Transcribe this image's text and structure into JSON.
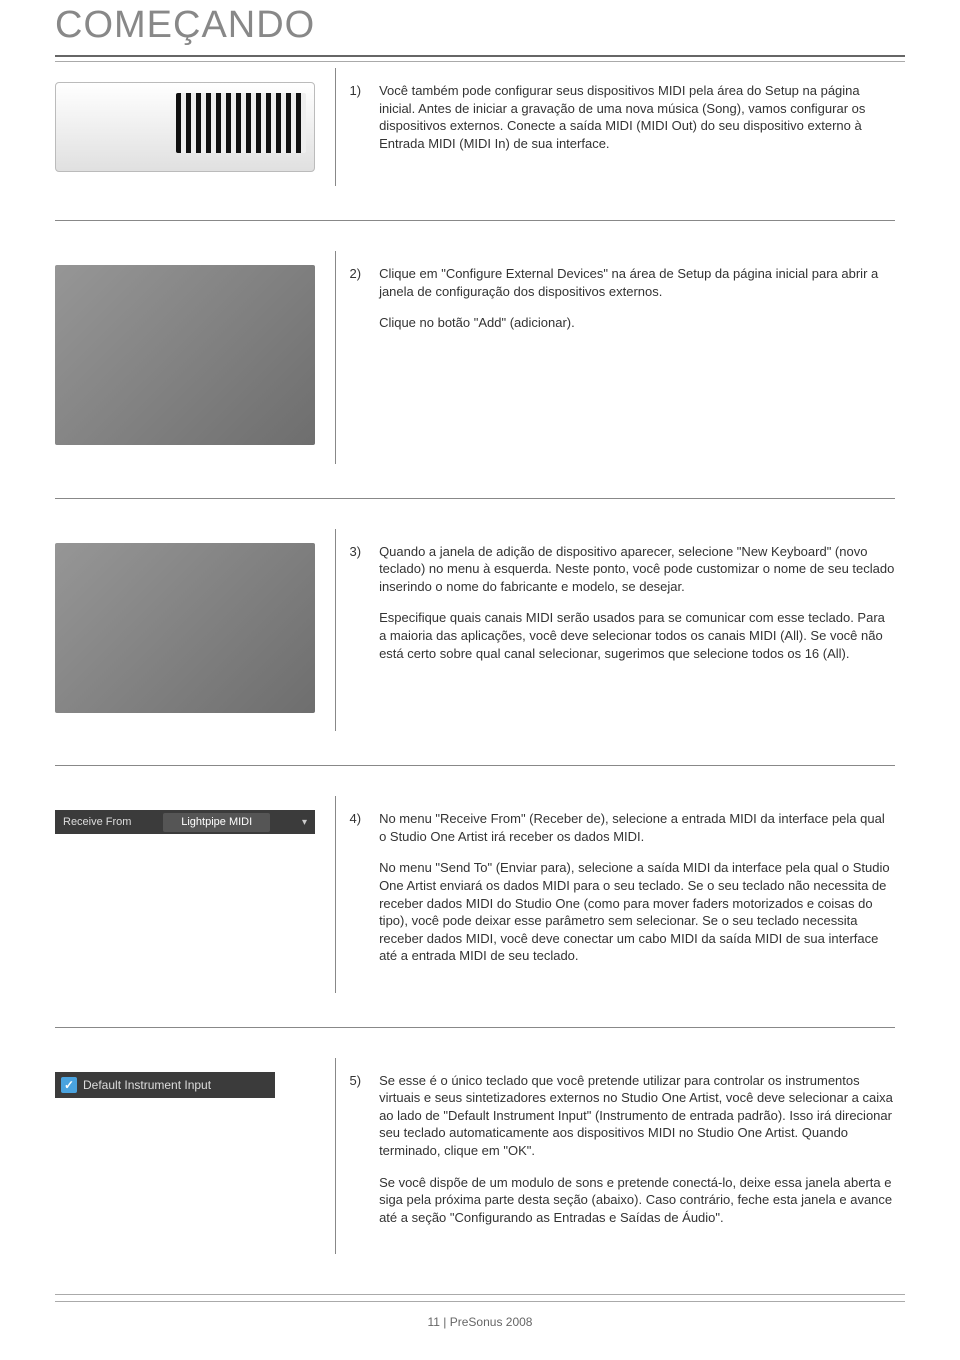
{
  "title": "COMEÇANDO",
  "steps": [
    {
      "num": "1)",
      "paras": [
        "Você também pode configurar seus dispositivos MIDI pela área do Setup na página inicial. Antes de iniciar a gravação de uma nova música (Song), vamos configurar os dispositivos externos. Conecte a saída MIDI (MIDI Out) do seu dispositivo externo à Entrada MIDI (MIDI In) de sua interface."
      ],
      "imgType": "keyboard"
    },
    {
      "num": "2)",
      "paras": [
        "Clique em \"Configure External Devices\" na área de Setup da página inicial para abrir a janela de configuração dos dispositivos externos.",
        "Clique no botão \"Add\" (adicionar)."
      ],
      "imgType": "options"
    },
    {
      "num": "3)",
      "paras": [
        "Quando a janela de adição de dispositivo aparecer, selecione \"New Keyboard\" (novo teclado) no menu à esquerda. Neste ponto, você pode customizar o nome de seu teclado inserindo o nome do fabricante e modelo, se desejar.",
        "Especifique quais canais MIDI serão usados para se comunicar com esse teclado. Para a maioria das aplicações, você deve selecionar todos os canais MIDI (All). Se você não está certo sobre qual canal selecionar, sugerimos que selecione todos os 16 (All)."
      ],
      "imgType": "adddev"
    },
    {
      "num": "4)",
      "paras": [
        "No menu \"Receive From\" (Receber de), selecione a entrada MIDI da interface pela qual o Studio One Artist irá receber os dados MIDI.",
        "No menu \"Send To\" (Enviar para), selecione a saída MIDI da interface pela qual o Studio One Artist enviará os dados MIDI para o seu teclado. Se o seu teclado não necessita de receber dados MIDI do Studio One (como para mover faders motorizados e coisas do tipo), você pode deixar esse parâmetro sem selecionar. Se o seu teclado necessita receber dados MIDI, você deve conectar um cabo MIDI da saída MIDI de sua interface até a entrada MIDI de seu teclado."
      ],
      "imgType": "receive",
      "receiveLabel": "Receive From",
      "receiveValue": "Lightpipe MIDI"
    },
    {
      "num": "5)",
      "paras": [
        "Se esse é o único teclado que você pretende utilizar para controlar os instrumentos virtuais e seus sintetizadores externos no Studio One Artist, você deve selecionar a caixa ao lado de \"Default Instrument Input\" (Instrumento de entrada padrão). Isso irá direcionar seu teclado automaticamente aos dispositivos MIDI no Studio One Artist. Quando terminado, clique em \"OK\".",
        "Se você dispõe de um modulo de sons e pretende conectá-lo, deixe essa janela aberta e siga pela próxima parte desta seção (abaixo). Caso contrário, feche esta janela e avance até a seção \"Configurando as Entradas e Saídas de Áudio\"."
      ],
      "imgType": "default",
      "defaultLabel": "Default Instrument Input"
    }
  ],
  "footer": "11 | PreSonus 2008"
}
